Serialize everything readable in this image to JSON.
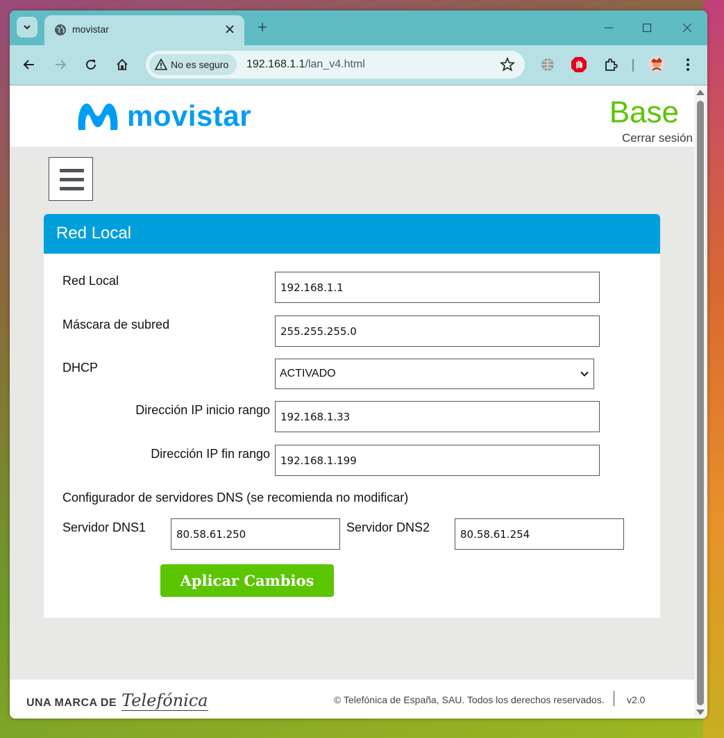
{
  "browser": {
    "tab_title": "movistar",
    "security_label": "No es seguro",
    "url_host": "192.168.1.1",
    "url_path": "/lan_v4.html"
  },
  "header": {
    "logo_text": "movistar",
    "brand": "Base",
    "logout": "Cerrar sesión"
  },
  "card": {
    "title": "Red Local"
  },
  "form": {
    "red_local_label": "Red Local",
    "red_local_value": "192.168.1.1",
    "mask_label": "Máscara de subred",
    "mask_value": "255.255.255.0",
    "dhcp_label": "DHCP",
    "dhcp_value": "ACTIVADO",
    "ip_start_label": "Dirección IP inicio rango",
    "ip_start_value": "192.168.1.33",
    "ip_end_label": "Dirección IP fin rango",
    "ip_end_value": "192.168.1.199",
    "dns_note": "Configurador de servidores DNS (se recomienda no modificar)",
    "dns1_label": "Servidor DNS1",
    "dns1_value": "80.58.61.250",
    "dns2_label": "Servidor DNS2",
    "dns2_value": "80.58.61.254",
    "apply_label": "Aplicar Cambios"
  },
  "footer": {
    "brand_prefix": "UNA MARCA DE",
    "brand_name": "Telefónica",
    "copyright": "© Telefónica de España, SAU. Todos los derechos reservados.",
    "version": "v2.0"
  },
  "colors": {
    "accent_blue": "#019fdb",
    "brand_green": "#5bc500",
    "browser_frame": "#5fbcc4"
  }
}
